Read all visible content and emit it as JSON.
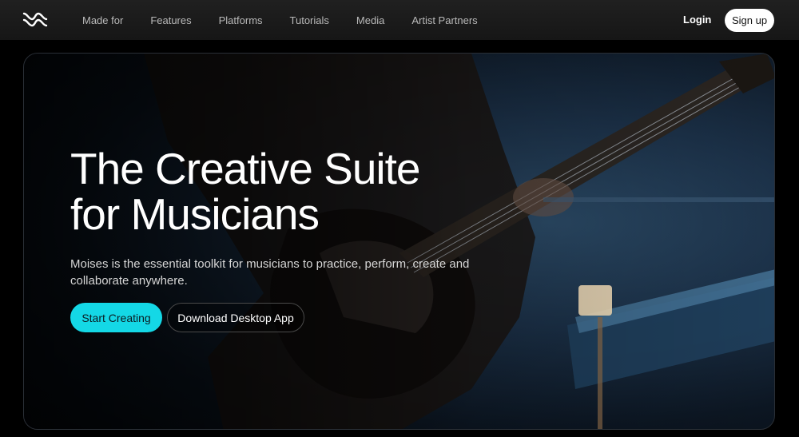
{
  "nav": {
    "logo_icon": "moises-wave-logo-icon",
    "links": [
      "Made for",
      "Features",
      "Platforms",
      "Tutorials",
      "Media",
      "Artist Partners"
    ],
    "login_label": "Login",
    "signup_label": "Sign up"
  },
  "hero": {
    "title_line1": "The Creative Suite",
    "title_line2": "for Musicians",
    "subtitle_line1": "Moises is the essential toolkit for musicians to practice, perform, create and",
    "subtitle_line2": "collaborate anywhere.",
    "primary_cta": "Start Creating",
    "secondary_cta": "Download Desktop App",
    "accent_color": "#14d8e6"
  }
}
